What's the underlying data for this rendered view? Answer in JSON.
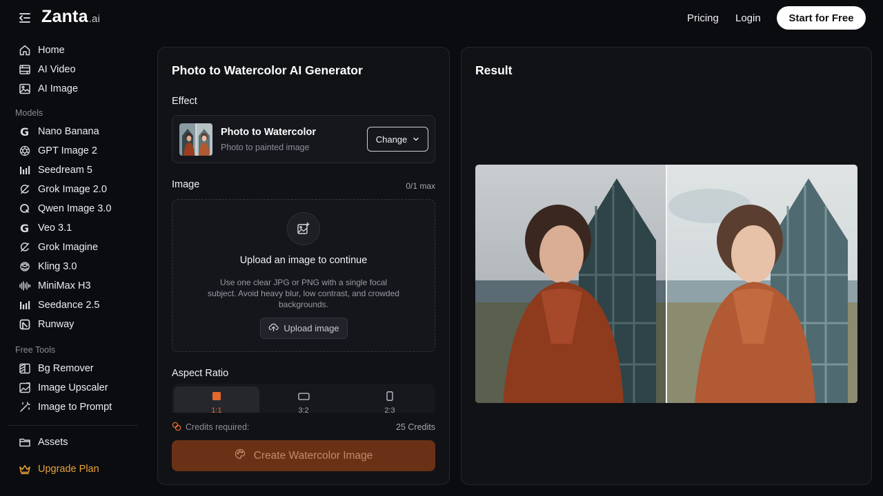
{
  "header": {
    "logo_main": "Zanta",
    "logo_suffix": ".ai",
    "nav_pricing": "Pricing",
    "nav_login": "Login",
    "cta": "Start for Free"
  },
  "sidebar": {
    "main": [
      {
        "label": "Home",
        "icon": "home-icon"
      },
      {
        "label": "AI Video",
        "icon": "video-icon"
      },
      {
        "label": "AI Image",
        "icon": "image-icon"
      }
    ],
    "models_title": "Models",
    "models": [
      {
        "label": "Nano Banana",
        "icon": "google-g-icon"
      },
      {
        "label": "GPT Image 2",
        "icon": "openai-icon"
      },
      {
        "label": "Seedream 5",
        "icon": "bars-icon"
      },
      {
        "label": "Grok Image 2.0",
        "icon": "grok-icon"
      },
      {
        "label": "Qwen Image 3.0",
        "icon": "qwen-icon"
      },
      {
        "label": "Veo 3.1",
        "icon": "google-g-icon"
      },
      {
        "label": "Grok Imagine",
        "icon": "grok-icon"
      },
      {
        "label": "Kling 3.0",
        "icon": "kling-icon"
      },
      {
        "label": "MiniMax H3",
        "icon": "waveform-icon"
      },
      {
        "label": "Seedance 2.5",
        "icon": "bars-icon"
      },
      {
        "label": "Runway",
        "icon": "runway-icon"
      }
    ],
    "tools_title": "Free Tools",
    "tools": [
      {
        "label": "Bg Remover",
        "icon": "bg-remover-icon"
      },
      {
        "label": "Image Upscaler",
        "icon": "upscaler-icon"
      },
      {
        "label": "Image to Prompt",
        "icon": "magic-wand-icon"
      }
    ],
    "assets": "Assets",
    "upgrade": "Upgrade Plan"
  },
  "generator": {
    "title": "Photo to Watercolor AI Generator",
    "effect_label": "Effect",
    "effect_name": "Photo to Watercolor",
    "effect_sub": "Photo to painted image",
    "change_btn": "Change",
    "image_label": "Image",
    "image_count": "0/1 max",
    "upload_title": "Upload an image to continue",
    "upload_desc": "Use one clear JPG or PNG with a single focal subject. Avoid heavy blur, low contrast, and crowded backgrounds.",
    "upload_btn": "Upload image",
    "aspect_label": "Aspect Ratio",
    "ratios": [
      "1:1",
      "3:2",
      "2:3"
    ],
    "selected_ratio": "1:1",
    "credits_label": "Credits required:",
    "credits_value": "25 Credits",
    "create_btn": "Create Watercolor Image"
  },
  "result": {
    "title": "Result"
  },
  "colors": {
    "accent": "#e3692c",
    "upgrade": "#e9a23b",
    "create_btn_bg": "#6b3116"
  }
}
